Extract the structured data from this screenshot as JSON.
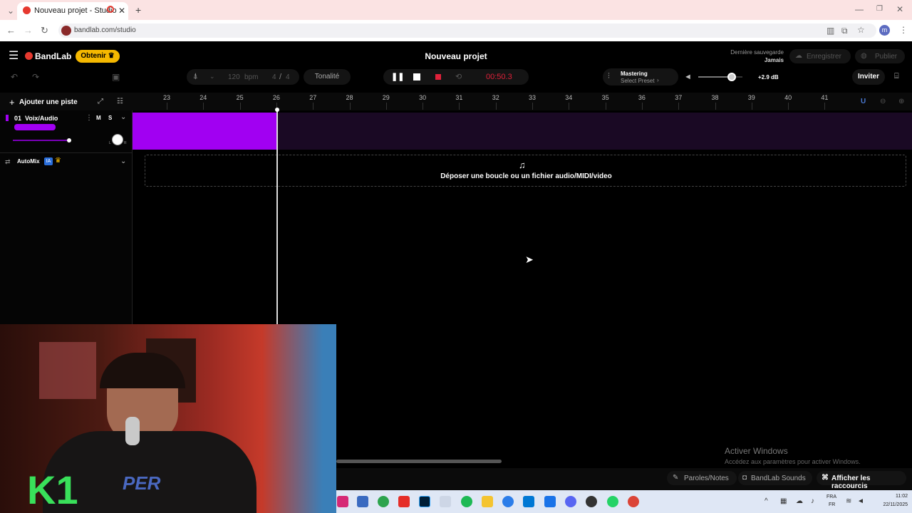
{
  "browser": {
    "tab_title": "Nouveau projet - Studio",
    "url": "bandlab.com/studio",
    "profile_initial": "m"
  },
  "header": {
    "brand": "BandLab",
    "obtain_label": "Obtenir",
    "project_title": "Nouveau projet",
    "last_save_label": "Dernière sauvegarde",
    "last_save_value": "Jamais",
    "save_label": "Enregistrer",
    "publish_label": "Publier"
  },
  "toolbar": {
    "bpm_value": "120",
    "bpm_unit": "bpm",
    "time_sig_num": "4",
    "time_sig_sep": "/",
    "time_sig_den": "4",
    "key_label": "Tonalité",
    "time_display": "00:50.3",
    "mastering_label": "Mastering",
    "mastering_preset": "Select Preset",
    "volume_db": "+2.9 dB",
    "volume_level": 0.75,
    "invite_label": "Inviter"
  },
  "tracks_panel": {
    "add_track_label": "Ajouter une piste",
    "track_name": "01  Voix/Audio",
    "mute_label": "M",
    "solo_label": "S",
    "automix_label": "AutoMix",
    "automix_badge": "IA",
    "pan_l": "L",
    "pan_r": "R"
  },
  "ruler": {
    "marks": [
      "23",
      "24",
      "25",
      "26",
      "27",
      "28",
      "29",
      "30",
      "31",
      "32",
      "33",
      "34",
      "35",
      "36",
      "37",
      "38",
      "39",
      "40",
      "41"
    ]
  },
  "drop_zone": {
    "text": "Déposer une boucle ou un fichier audio/MIDI/video"
  },
  "footer": {
    "lyrics_label": "Paroles/Notes",
    "sounds_label": "BandLab Sounds",
    "shortcuts_label": "Afficher les raccourcis"
  },
  "watermark": {
    "title": "Activer Windows",
    "subtitle": "Accédez aux paramètres pour activer Windows."
  },
  "taskbar": {
    "lang_top": "FRA",
    "lang_bottom": "FR",
    "time": "11:02",
    "date": "22/11/2025"
  },
  "overlay": {
    "logo_text": "K1",
    "cam_text": "PER"
  },
  "colors": {
    "accent_purple": "#a100f2",
    "obtain_yellow": "#f5b800",
    "record_red": "#e0213a",
    "brand_red": "#e6392f"
  }
}
